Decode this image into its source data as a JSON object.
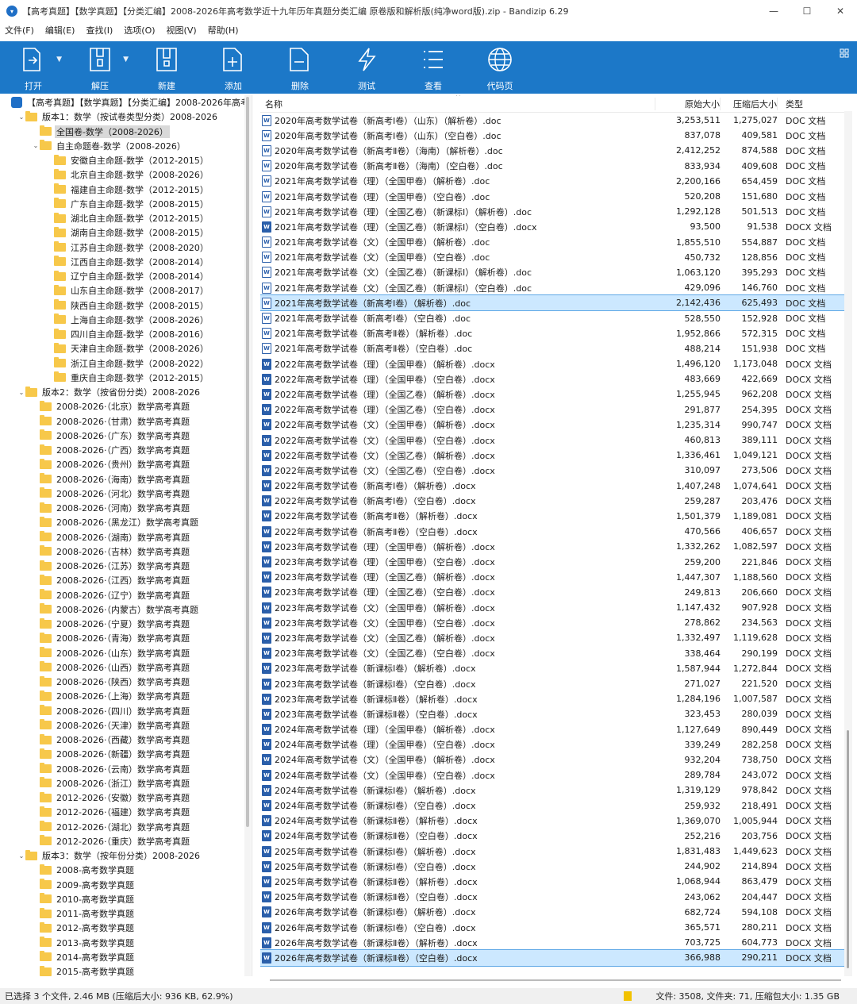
{
  "window": {
    "title": "【高考真题】【数学真题】【分类汇编】2008-2026年高考数学近十九年历年真题分类汇编  原卷版和解析版(纯净word版).zip - Bandizip 6.29",
    "controls": [
      "—",
      "☐",
      "✕"
    ]
  },
  "menu": [
    "文件(F)",
    "编辑(E)",
    "查找(I)",
    "选项(O)",
    "视图(V)",
    "帮助(H)"
  ],
  "toolbar": [
    {
      "label": "打开",
      "icon": "open-icon",
      "dropdown": true
    },
    {
      "label": "解压",
      "icon": "extract-icon",
      "dropdown": true
    },
    {
      "label": "新建",
      "icon": "new-archive-icon"
    },
    {
      "label": "添加",
      "icon": "add-icon"
    },
    {
      "label": "删除",
      "icon": "delete-icon"
    },
    {
      "label": "测试",
      "icon": "test-icon"
    },
    {
      "label": "查看",
      "icon": "view-icon"
    },
    {
      "label": "代码页",
      "icon": "codepage-icon"
    }
  ],
  "tree": [
    {
      "text": "【高考真题】【数学真题】【分类汇编】2008-2026年高考",
      "level": 0,
      "kind": "zip",
      "arrow": ""
    },
    {
      "text": "版本1：数学（按试卷类型分类）2008-2026",
      "level": 1,
      "kind": "folder",
      "arrow": "⌄"
    },
    {
      "text": "全国卷-数学（2008-2026）",
      "level": 2,
      "kind": "folder",
      "arrow": "",
      "sel": true
    },
    {
      "text": "自主命题卷-数学（2008-2026）",
      "level": 2,
      "kind": "folder",
      "arrow": "⌄"
    },
    {
      "text": "安徽自主命题-数学（2012-2015）",
      "level": 3,
      "kind": "folder",
      "arrow": ""
    },
    {
      "text": "北京自主命题-数学（2008-2026）",
      "level": 3,
      "kind": "folder",
      "arrow": ""
    },
    {
      "text": "福建自主命题-数学（2012-2015）",
      "level": 3,
      "kind": "folder",
      "arrow": ""
    },
    {
      "text": "广东自主命题-数学（2008-2015）",
      "level": 3,
      "kind": "folder",
      "arrow": ""
    },
    {
      "text": "湖北自主命题-数学（2012-2015）",
      "level": 3,
      "kind": "folder",
      "arrow": ""
    },
    {
      "text": "湖南自主命题-数学（2008-2015）",
      "level": 3,
      "kind": "folder",
      "arrow": ""
    },
    {
      "text": "江苏自主命题-数学（2008-2020）",
      "level": 3,
      "kind": "folder",
      "arrow": ""
    },
    {
      "text": "江西自主命题-数学（2008-2014）",
      "level": 3,
      "kind": "folder",
      "arrow": ""
    },
    {
      "text": "辽宁自主命题-数学（2008-2014）",
      "level": 3,
      "kind": "folder",
      "arrow": ""
    },
    {
      "text": "山东自主命题-数学（2008-2017）",
      "level": 3,
      "kind": "folder",
      "arrow": ""
    },
    {
      "text": "陕西自主命题-数学（2008-2015）",
      "level": 3,
      "kind": "folder",
      "arrow": ""
    },
    {
      "text": "上海自主命题-数学（2008-2026）",
      "level": 3,
      "kind": "folder",
      "arrow": ""
    },
    {
      "text": "四川自主命题-数学（2008-2016）",
      "level": 3,
      "kind": "folder",
      "arrow": ""
    },
    {
      "text": "天津自主命题-数学（2008-2026）",
      "level": 3,
      "kind": "folder",
      "arrow": ""
    },
    {
      "text": "浙江自主命题-数学（2008-2022）",
      "level": 3,
      "kind": "folder",
      "arrow": ""
    },
    {
      "text": "重庆自主命题-数学（2012-2015）",
      "level": 3,
      "kind": "folder",
      "arrow": ""
    },
    {
      "text": "版本2：数学（按省份分类）2008-2026",
      "level": 1,
      "kind": "folder",
      "arrow": "⌄"
    },
    {
      "text": "2008-2026·（北京）数学高考真题",
      "level": 2,
      "kind": "folder",
      "arrow": ""
    },
    {
      "text": "2008-2026·（甘肃）数学高考真题",
      "level": 2,
      "kind": "folder",
      "arrow": ""
    },
    {
      "text": "2008-2026·（广东）数学高考真题",
      "level": 2,
      "kind": "folder",
      "arrow": ""
    },
    {
      "text": "2008-2026·（广西）数学高考真题",
      "level": 2,
      "kind": "folder",
      "arrow": ""
    },
    {
      "text": "2008-2026·（贵州）数学高考真题",
      "level": 2,
      "kind": "folder",
      "arrow": ""
    },
    {
      "text": "2008-2026·（海南）数学高考真题",
      "level": 2,
      "kind": "folder",
      "arrow": ""
    },
    {
      "text": "2008-2026·（河北）数学高考真题",
      "level": 2,
      "kind": "folder",
      "arrow": ""
    },
    {
      "text": "2008-2026·（河南）数学高考真题",
      "level": 2,
      "kind": "folder",
      "arrow": ""
    },
    {
      "text": "2008-2026·（黑龙江）数学高考真题",
      "level": 2,
      "kind": "folder",
      "arrow": ""
    },
    {
      "text": "2008-2026·（湖南）数学高考真题",
      "level": 2,
      "kind": "folder",
      "arrow": ""
    },
    {
      "text": "2008-2026·（吉林）数学高考真题",
      "level": 2,
      "kind": "folder",
      "arrow": ""
    },
    {
      "text": "2008-2026·（江苏）数学高考真题",
      "level": 2,
      "kind": "folder",
      "arrow": ""
    },
    {
      "text": "2008-2026·（江西）数学高考真题",
      "level": 2,
      "kind": "folder",
      "arrow": ""
    },
    {
      "text": "2008-2026·（辽宁）数学高考真题",
      "level": 2,
      "kind": "folder",
      "arrow": ""
    },
    {
      "text": "2008-2026·（内蒙古）数学高考真题",
      "level": 2,
      "kind": "folder",
      "arrow": ""
    },
    {
      "text": "2008-2026·（宁夏）数学高考真题",
      "level": 2,
      "kind": "folder",
      "arrow": ""
    },
    {
      "text": "2008-2026·（青海）数学高考真题",
      "level": 2,
      "kind": "folder",
      "arrow": ""
    },
    {
      "text": "2008-2026·（山东）数学高考真题",
      "level": 2,
      "kind": "folder",
      "arrow": ""
    },
    {
      "text": "2008-2026·（山西）数学高考真题",
      "level": 2,
      "kind": "folder",
      "arrow": ""
    },
    {
      "text": "2008-2026·（陕西）数学高考真题",
      "level": 2,
      "kind": "folder",
      "arrow": ""
    },
    {
      "text": "2008-2026·（上海）数学高考真题",
      "level": 2,
      "kind": "folder",
      "arrow": ""
    },
    {
      "text": "2008-2026·（四川）数学高考真题",
      "level": 2,
      "kind": "folder",
      "arrow": ""
    },
    {
      "text": "2008-2026·（天津）数学高考真题",
      "level": 2,
      "kind": "folder",
      "arrow": ""
    },
    {
      "text": "2008-2026·（西藏）数学高考真题",
      "level": 2,
      "kind": "folder",
      "arrow": ""
    },
    {
      "text": "2008-2026·（新疆）数学高考真题",
      "level": 2,
      "kind": "folder",
      "arrow": ""
    },
    {
      "text": "2008-2026·（云南）数学高考真题",
      "level": 2,
      "kind": "folder",
      "arrow": ""
    },
    {
      "text": "2008-2026·（浙江）数学高考真题",
      "level": 2,
      "kind": "folder",
      "arrow": ""
    },
    {
      "text": "2012-2026·（安徽）数学高考真题",
      "level": 2,
      "kind": "folder",
      "arrow": ""
    },
    {
      "text": "2012-2026·（福建）数学高考真题",
      "level": 2,
      "kind": "folder",
      "arrow": ""
    },
    {
      "text": "2012-2026·（湖北）数学高考真题",
      "level": 2,
      "kind": "folder",
      "arrow": ""
    },
    {
      "text": "2012-2026·（重庆）数学高考真题",
      "level": 2,
      "kind": "folder",
      "arrow": ""
    },
    {
      "text": "版本3：数学（按年份分类）2008-2026",
      "level": 1,
      "kind": "folder",
      "arrow": "⌄"
    },
    {
      "text": "2008-高考数学真题",
      "level": 2,
      "kind": "folder",
      "arrow": ""
    },
    {
      "text": "2009-高考数学真题",
      "level": 2,
      "kind": "folder",
      "arrow": ""
    },
    {
      "text": "2010-高考数学真题",
      "level": 2,
      "kind": "folder",
      "arrow": ""
    },
    {
      "text": "2011-高考数学真题",
      "level": 2,
      "kind": "folder",
      "arrow": ""
    },
    {
      "text": "2012-高考数学真题",
      "level": 2,
      "kind": "folder",
      "arrow": ""
    },
    {
      "text": "2013-高考数学真题",
      "level": 2,
      "kind": "folder",
      "arrow": ""
    },
    {
      "text": "2014-高考数学真题",
      "level": 2,
      "kind": "folder",
      "arrow": ""
    },
    {
      "text": "2015-高考数学真题",
      "level": 2,
      "kind": "folder",
      "arrow": ""
    }
  ],
  "columns": {
    "name": "名称",
    "original": "原始大小",
    "compressed": "压缩后大小",
    "type": "类型"
  },
  "files": [
    {
      "name": "2020年高考数学试卷（新高考Ⅰ卷）（山东）（解析卷）.doc",
      "orig": "3,253,511",
      "comp": "1,275,027",
      "type": "DOC 文档"
    },
    {
      "name": "2020年高考数学试卷（新高考Ⅰ卷）（山东）（空白卷）.doc",
      "orig": "837,078",
      "comp": "409,581",
      "type": "DOC 文档"
    },
    {
      "name": "2020年高考数学试卷（新高考Ⅱ卷）（海南）（解析卷）.doc",
      "orig": "2,412,252",
      "comp": "874,588",
      "type": "DOC 文档"
    },
    {
      "name": "2020年高考数学试卷（新高考Ⅱ卷）（海南）（空白卷）.doc",
      "orig": "833,934",
      "comp": "409,608",
      "type": "DOC 文档"
    },
    {
      "name": "2021年高考数学试卷（理）（全国甲卷）（解析卷）.doc",
      "orig": "2,200,166",
      "comp": "654,459",
      "type": "DOC 文档"
    },
    {
      "name": "2021年高考数学试卷（理）（全国甲卷）（空白卷）.doc",
      "orig": "520,208",
      "comp": "151,680",
      "type": "DOC 文档"
    },
    {
      "name": "2021年高考数学试卷（理）（全国乙卷）（新课标Ⅰ）（解析卷）.doc",
      "orig": "1,292,128",
      "comp": "501,513",
      "type": "DOC 文档"
    },
    {
      "name": "2021年高考数学试卷（理）（全国乙卷）（新课标Ⅰ）（空白卷）.docx",
      "orig": "93,500",
      "comp": "91,538",
      "type": "DOCX 文档"
    },
    {
      "name": "2021年高考数学试卷（文）（全国甲卷）（解析卷）.doc",
      "orig": "1,855,510",
      "comp": "554,887",
      "type": "DOC 文档"
    },
    {
      "name": "2021年高考数学试卷（文）（全国甲卷）（空白卷）.doc",
      "orig": "450,732",
      "comp": "128,856",
      "type": "DOC 文档"
    },
    {
      "name": "2021年高考数学试卷（文）（全国乙卷）（新课标Ⅰ）（解析卷）.doc",
      "orig": "1,063,120",
      "comp": "395,293",
      "type": "DOC 文档"
    },
    {
      "name": "2021年高考数学试卷（文）（全国乙卷）（新课标Ⅰ）（空白卷）.doc",
      "orig": "429,096",
      "comp": "146,760",
      "type": "DOC 文档"
    },
    {
      "name": "2021年高考数学试卷（新高考Ⅰ卷）（解析卷）.doc",
      "orig": "2,142,436",
      "comp": "625,493",
      "type": "DOC 文档",
      "sel": true
    },
    {
      "name": "2021年高考数学试卷（新高考Ⅰ卷）（空白卷）.doc",
      "orig": "528,550",
      "comp": "152,928",
      "type": "DOC 文档"
    },
    {
      "name": "2021年高考数学试卷（新高考Ⅱ卷）（解析卷）.doc",
      "orig": "1,952,866",
      "comp": "572,315",
      "type": "DOC 文档"
    },
    {
      "name": "2021年高考数学试卷（新高考Ⅱ卷）（空白卷）.doc",
      "orig": "488,214",
      "comp": "151,938",
      "type": "DOC 文档"
    },
    {
      "name": "2022年高考数学试卷（理）（全国甲卷）（解析卷）.docx",
      "orig": "1,496,120",
      "comp": "1,173,048",
      "type": "DOCX 文档"
    },
    {
      "name": "2022年高考数学试卷（理）（全国甲卷）（空白卷）.docx",
      "orig": "483,669",
      "comp": "422,669",
      "type": "DOCX 文档"
    },
    {
      "name": "2022年高考数学试卷（理）（全国乙卷）（解析卷）.docx",
      "orig": "1,255,945",
      "comp": "962,208",
      "type": "DOCX 文档"
    },
    {
      "name": "2022年高考数学试卷（理）（全国乙卷）（空白卷）.docx",
      "orig": "291,877",
      "comp": "254,395",
      "type": "DOCX 文档"
    },
    {
      "name": "2022年高考数学试卷（文）（全国甲卷）（解析卷）.docx",
      "orig": "1,235,314",
      "comp": "990,747",
      "type": "DOCX 文档"
    },
    {
      "name": "2022年高考数学试卷（文）（全国甲卷）（空白卷）.docx",
      "orig": "460,813",
      "comp": "389,111",
      "type": "DOCX 文档"
    },
    {
      "name": "2022年高考数学试卷（文）（全国乙卷）（解析卷）.docx",
      "orig": "1,336,461",
      "comp": "1,049,121",
      "type": "DOCX 文档"
    },
    {
      "name": "2022年高考数学试卷（文）（全国乙卷）（空白卷）.docx",
      "orig": "310,097",
      "comp": "273,506",
      "type": "DOCX 文档"
    },
    {
      "name": "2022年高考数学试卷（新高考Ⅰ卷）（解析卷）.docx",
      "orig": "1,407,248",
      "comp": "1,074,641",
      "type": "DOCX 文档"
    },
    {
      "name": "2022年高考数学试卷（新高考Ⅰ卷）（空白卷）.docx",
      "orig": "259,287",
      "comp": "203,476",
      "type": "DOCX 文档"
    },
    {
      "name": "2022年高考数学试卷（新高考Ⅱ卷）（解析卷）.docx",
      "orig": "1,501,379",
      "comp": "1,189,081",
      "type": "DOCX 文档"
    },
    {
      "name": "2022年高考数学试卷（新高考Ⅱ卷）（空白卷）.docx",
      "orig": "470,566",
      "comp": "406,657",
      "type": "DOCX 文档"
    },
    {
      "name": "2023年高考数学试卷（理）（全国甲卷）（解析卷）.docx",
      "orig": "1,332,262",
      "comp": "1,082,597",
      "type": "DOCX 文档"
    },
    {
      "name": "2023年高考数学试卷（理）（全国甲卷）（空白卷）.docx",
      "orig": "259,200",
      "comp": "221,846",
      "type": "DOCX 文档"
    },
    {
      "name": "2023年高考数学试卷（理）（全国乙卷）（解析卷）.docx",
      "orig": "1,447,307",
      "comp": "1,188,560",
      "type": "DOCX 文档"
    },
    {
      "name": "2023年高考数学试卷（理）（全国乙卷）（空白卷）.docx",
      "orig": "249,813",
      "comp": "206,660",
      "type": "DOCX 文档"
    },
    {
      "name": "2023年高考数学试卷（文）（全国甲卷）（解析卷）.docx",
      "orig": "1,147,432",
      "comp": "907,928",
      "type": "DOCX 文档"
    },
    {
      "name": "2023年高考数学试卷（文）（全国甲卷）（空白卷）.docx",
      "orig": "278,862",
      "comp": "234,563",
      "type": "DOCX 文档"
    },
    {
      "name": "2023年高考数学试卷（文）（全国乙卷）（解析卷）.docx",
      "orig": "1,332,497",
      "comp": "1,119,628",
      "type": "DOCX 文档"
    },
    {
      "name": "2023年高考数学试卷（文）（全国乙卷）（空白卷）.docx",
      "orig": "338,464",
      "comp": "290,199",
      "type": "DOCX 文档"
    },
    {
      "name": "2023年高考数学试卷（新课标Ⅰ卷）（解析卷）.docx",
      "orig": "1,587,944",
      "comp": "1,272,844",
      "type": "DOCX 文档"
    },
    {
      "name": "2023年高考数学试卷（新课标Ⅰ卷）（空白卷）.docx",
      "orig": "271,027",
      "comp": "221,520",
      "type": "DOCX 文档"
    },
    {
      "name": "2023年高考数学试卷（新课标Ⅱ卷）（解析卷）.docx",
      "orig": "1,284,196",
      "comp": "1,007,587",
      "type": "DOCX 文档"
    },
    {
      "name": "2023年高考数学试卷（新课标Ⅱ卷）（空白卷）.docx",
      "orig": "323,453",
      "comp": "280,039",
      "type": "DOCX 文档"
    },
    {
      "name": "2024年高考数学试卷（理）（全国甲卷）（解析卷）.docx",
      "orig": "1,127,649",
      "comp": "890,449",
      "type": "DOCX 文档"
    },
    {
      "name": "2024年高考数学试卷（理）（全国甲卷）（空白卷）.docx",
      "orig": "339,249",
      "comp": "282,258",
      "type": "DOCX 文档"
    },
    {
      "name": "2024年高考数学试卷（文）（全国甲卷）（解析卷）.docx",
      "orig": "932,204",
      "comp": "738,750",
      "type": "DOCX 文档"
    },
    {
      "name": "2024年高考数学试卷（文）（全国甲卷）（空白卷）.docx",
      "orig": "289,784",
      "comp": "243,072",
      "type": "DOCX 文档"
    },
    {
      "name": "2024年高考数学试卷（新课标Ⅰ卷）（解析卷）.docx",
      "orig": "1,319,129",
      "comp": "978,842",
      "type": "DOCX 文档"
    },
    {
      "name": "2024年高考数学试卷（新课标Ⅰ卷）（空白卷）.docx",
      "orig": "259,932",
      "comp": "218,491",
      "type": "DOCX 文档"
    },
    {
      "name": "2024年高考数学试卷（新课标Ⅱ卷）（解析卷）.docx",
      "orig": "1,369,070",
      "comp": "1,005,944",
      "type": "DOCX 文档"
    },
    {
      "name": "2024年高考数学试卷（新课标Ⅱ卷）（空白卷）.docx",
      "orig": "252,216",
      "comp": "203,756",
      "type": "DOCX 文档"
    },
    {
      "name": "2025年高考数学试卷（新课标Ⅰ卷）（解析卷）.docx",
      "orig": "1,831,483",
      "comp": "1,449,623",
      "type": "DOCX 文档"
    },
    {
      "name": "2025年高考数学试卷（新课标Ⅰ卷）（空白卷）.docx",
      "orig": "244,902",
      "comp": "214,894",
      "type": "DOCX 文档"
    },
    {
      "name": "2025年高考数学试卷（新课标Ⅱ卷）（解析卷）.docx",
      "orig": "1,068,944",
      "comp": "863,479",
      "type": "DOCX 文档"
    },
    {
      "name": "2025年高考数学试卷（新课标Ⅱ卷）（空白卷）.docx",
      "orig": "243,062",
      "comp": "204,447",
      "type": "DOCX 文档"
    },
    {
      "name": "2026年高考数学试卷（新课标Ⅰ卷）（解析卷）.docx",
      "orig": "682,724",
      "comp": "594,108",
      "type": "DOCX 文档"
    },
    {
      "name": "2026年高考数学试卷（新课标Ⅰ卷）（空白卷）.docx",
      "orig": "365,571",
      "comp": "280,211",
      "type": "DOCX 文档"
    },
    {
      "name": "2026年高考数学试卷（新课标Ⅱ卷）（解析卷）.docx",
      "orig": "703,725",
      "comp": "604,773",
      "type": "DOCX 文档"
    },
    {
      "name": "2026年高考数学试卷（新课标Ⅱ卷）（空白卷）.docx",
      "orig": "366,988",
      "comp": "290,211",
      "type": "DOCX 文档",
      "sel": true
    }
  ],
  "status": {
    "left": "已选择 3 个文件, 2.46 MB (压缩后大小: 936 KB, 62.9%)",
    "right": "文件: 3508, 文件夹: 71, 压缩包大小: 1.35 GB"
  },
  "colors": {
    "toolbar_bg": "#1c78c8",
    "selection_bg": "#cce8ff",
    "folder": "#f7c84a"
  }
}
